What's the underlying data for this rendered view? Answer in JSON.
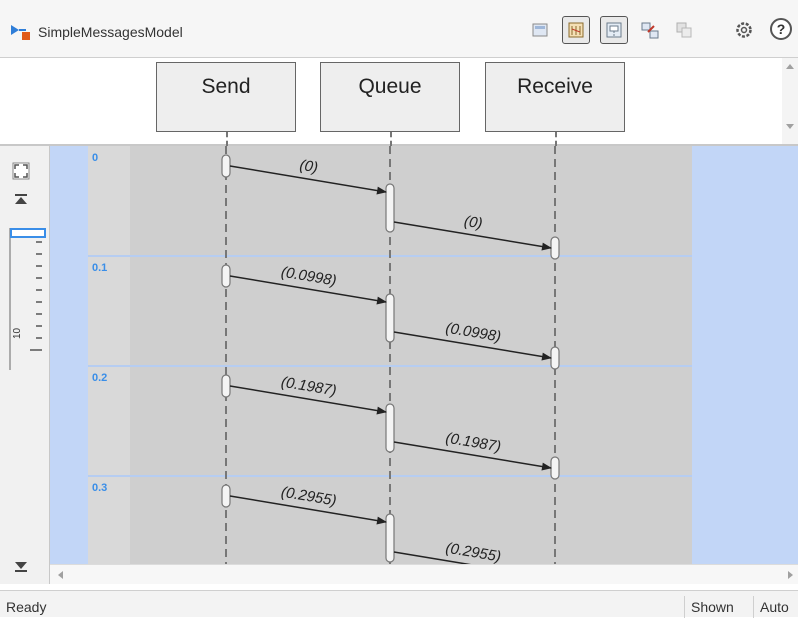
{
  "window": {
    "model_name": "SimpleMessagesModel"
  },
  "toolbar": {
    "buttons": [
      {
        "name": "block-icon",
        "active": false
      },
      {
        "name": "timeline-icon",
        "active": true
      },
      {
        "name": "lifeline-icon",
        "active": true
      },
      {
        "name": "hierarchy-icon",
        "active": false
      },
      {
        "name": "export-icon",
        "active": false
      },
      {
        "name": "settings-icon",
        "active": false
      }
    ],
    "help_label": "?"
  },
  "lifelines": [
    {
      "name": "Send"
    },
    {
      "name": "Queue"
    },
    {
      "name": "Receive"
    }
  ],
  "navigation": {
    "ruler_value": "10"
  },
  "timeline": {
    "time_labels": [
      "0",
      "0.1",
      "0.2",
      "0.3"
    ],
    "messages": [
      {
        "time": "0",
        "from": "Send",
        "to": "Queue",
        "label": "(0)"
      },
      {
        "time": "0",
        "from": "Queue",
        "to": "Receive",
        "label": "(0)"
      },
      {
        "time": "0.1",
        "from": "Send",
        "to": "Queue",
        "label": "(0.0998)"
      },
      {
        "time": "0.1",
        "from": "Queue",
        "to": "Receive",
        "label": "(0.0998)"
      },
      {
        "time": "0.2",
        "from": "Send",
        "to": "Queue",
        "label": "(0.1987)"
      },
      {
        "time": "0.2",
        "from": "Queue",
        "to": "Receive",
        "label": "(0.1987)"
      },
      {
        "time": "0.3",
        "from": "Send",
        "to": "Queue",
        "label": "(0.2955)"
      },
      {
        "time": "0.3",
        "from": "Queue",
        "to": "Receive",
        "label": "(0.2955)"
      }
    ]
  },
  "colors": {
    "selection_blue": "#c2d6f7",
    "time_label_blue": "#3a8ee8",
    "band_gray": "#cfcfcf",
    "gutter_gray": "#d9d9d9",
    "band_separator": "#b6cdf2"
  },
  "status": {
    "text": "Ready",
    "shown": "Shown",
    "auto": "Auto"
  }
}
